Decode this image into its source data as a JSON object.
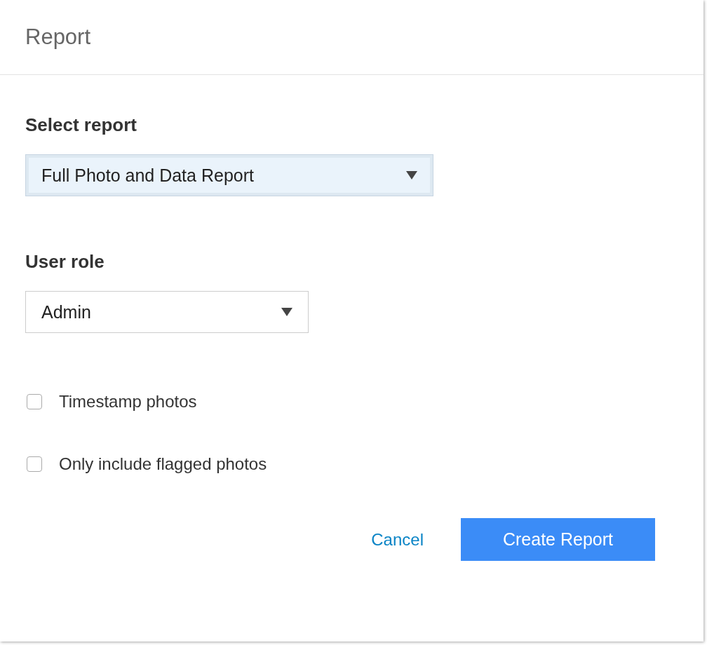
{
  "dialog": {
    "title": "Report"
  },
  "fields": [
    {
      "label": "Select report",
      "value": "Full Photo and Data Report",
      "focused": true
    },
    {
      "label": "User role",
      "value": "Admin",
      "focused": false
    }
  ],
  "options": [
    {
      "label": "Timestamp photos",
      "checked": false
    },
    {
      "label": "Only include flagged photos",
      "checked": false
    }
  ],
  "buttons": [
    {
      "kind": "link",
      "label": "Cancel"
    },
    {
      "kind": "primary",
      "label": "Create Report"
    }
  ]
}
